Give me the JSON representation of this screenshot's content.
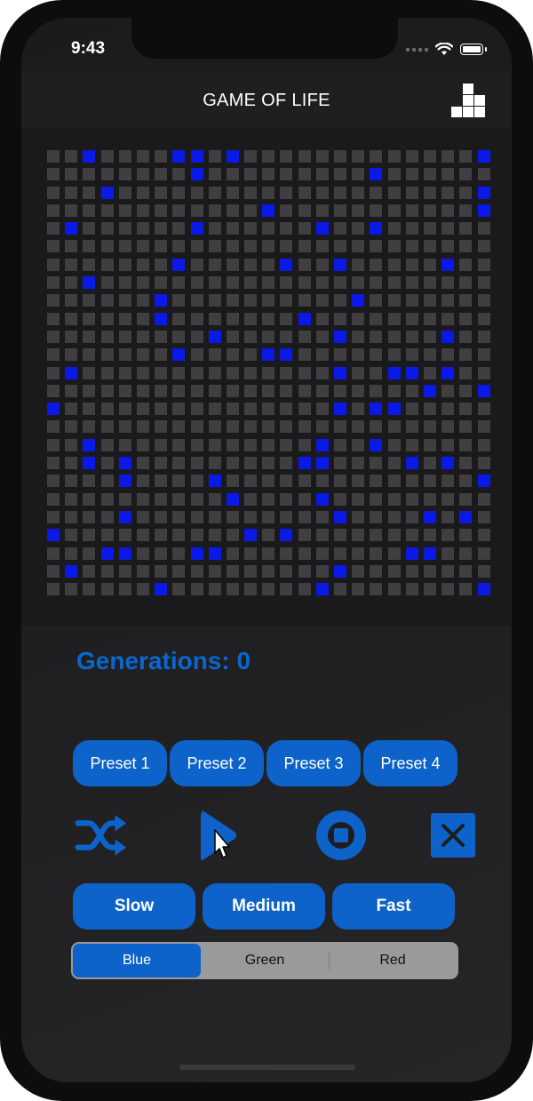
{
  "status_bar": {
    "time": "9:43"
  },
  "nav": {
    "title": "GAME OF LIFE",
    "icon": "blocks-icon"
  },
  "grid": {
    "rows": 25,
    "cols": 25,
    "alive_color": "#0b19e6",
    "dead_color": "#3f3f42",
    "alive": [
      [
        0,
        2
      ],
      [
        0,
        7
      ],
      [
        0,
        8
      ],
      [
        0,
        10
      ],
      [
        0,
        24
      ],
      [
        1,
        8
      ],
      [
        1,
        18
      ],
      [
        2,
        3
      ],
      [
        2,
        24
      ],
      [
        3,
        12
      ],
      [
        3,
        24
      ],
      [
        4,
        1
      ],
      [
        4,
        8
      ],
      [
        4,
        15
      ],
      [
        4,
        18
      ],
      [
        6,
        7
      ],
      [
        6,
        13
      ],
      [
        6,
        16
      ],
      [
        6,
        22
      ],
      [
        7,
        2
      ],
      [
        8,
        6
      ],
      [
        8,
        17
      ],
      [
        9,
        6
      ],
      [
        9,
        14
      ],
      [
        10,
        9
      ],
      [
        10,
        16
      ],
      [
        10,
        22
      ],
      [
        11,
        7
      ],
      [
        11,
        12
      ],
      [
        11,
        13
      ],
      [
        12,
        1
      ],
      [
        12,
        16
      ],
      [
        12,
        19
      ],
      [
        12,
        20
      ],
      [
        12,
        22
      ],
      [
        13,
        21
      ],
      [
        13,
        24
      ],
      [
        14,
        0
      ],
      [
        14,
        16
      ],
      [
        14,
        18
      ],
      [
        14,
        19
      ],
      [
        16,
        2
      ],
      [
        16,
        15
      ],
      [
        16,
        18
      ],
      [
        17,
        2
      ],
      [
        17,
        4
      ],
      [
        17,
        14
      ],
      [
        17,
        15
      ],
      [
        17,
        20
      ],
      [
        17,
        22
      ],
      [
        18,
        4
      ],
      [
        18,
        9
      ],
      [
        18,
        24
      ],
      [
        19,
        10
      ],
      [
        19,
        15
      ],
      [
        20,
        4
      ],
      [
        20,
        16
      ],
      [
        20,
        21
      ],
      [
        20,
        23
      ],
      [
        21,
        0
      ],
      [
        21,
        11
      ],
      [
        21,
        13
      ],
      [
        22,
        3
      ],
      [
        22,
        4
      ],
      [
        22,
        8
      ],
      [
        22,
        9
      ],
      [
        22,
        20
      ],
      [
        22,
        21
      ],
      [
        23,
        1
      ],
      [
        23,
        16
      ],
      [
        24,
        6
      ],
      [
        24,
        15
      ],
      [
        24,
        24
      ]
    ]
  },
  "generations_label": "Generations: 0",
  "presets": [
    "Preset 1",
    "Preset 2",
    "Preset 3",
    "Preset 4"
  ],
  "controls": {
    "accent": "#0d63c9",
    "icons": [
      "shuffle-icon",
      "play-icon",
      "stop-icon",
      "clear-icon"
    ]
  },
  "speeds": [
    "Slow",
    "Medium",
    "Fast"
  ],
  "color_picker": {
    "options": [
      "Blue",
      "Green",
      "Red"
    ],
    "selected": "Blue"
  }
}
